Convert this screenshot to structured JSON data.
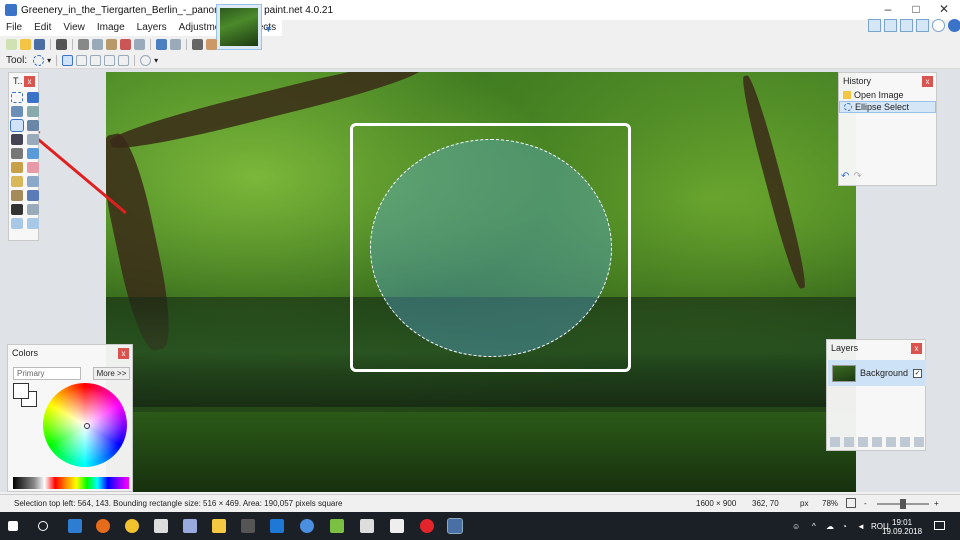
{
  "window": {
    "title": "Greenery_in_the_Tiergarten_Berlin_-_panoramio.jpg - paint.net 4.0.21",
    "minimize": "–",
    "maximize": "□",
    "close": "✕"
  },
  "menu": [
    "File",
    "Edit",
    "View",
    "Image",
    "Layers",
    "Adjustments",
    "Effects"
  ],
  "toolbar": {
    "tool_label": "Tool:"
  },
  "tools_panel": {
    "title": "T..",
    "close": "x"
  },
  "history": {
    "title": "History",
    "close": "x",
    "items": [
      "Open Image",
      "Ellipse Select"
    ],
    "undo": "↶",
    "redo": "↷"
  },
  "colors": {
    "title": "Colors",
    "close": "x",
    "primary_select": "Primary",
    "more_button": "More >>"
  },
  "layers": {
    "title": "Layers",
    "close": "x",
    "items": [
      {
        "name": "Background",
        "visible": true
      }
    ]
  },
  "status": {
    "selection_info": "Selection top left: 564, 143. Bounding rectangle size: 516 × 469. Area: 190,057 pixels square",
    "image_size": "1600 × 900",
    "cursor_pos": "362, 70",
    "unit": "px",
    "zoom": "78%"
  },
  "taskbar": {
    "lang": "ROU",
    "time": "19:01",
    "date": "19.09.2018"
  },
  "colors_theme": {
    "accent": "#3b73c9",
    "close_red": "#d9534f",
    "annotation_arrow": "#e02020",
    "selection_fill": "#5aaadc"
  }
}
